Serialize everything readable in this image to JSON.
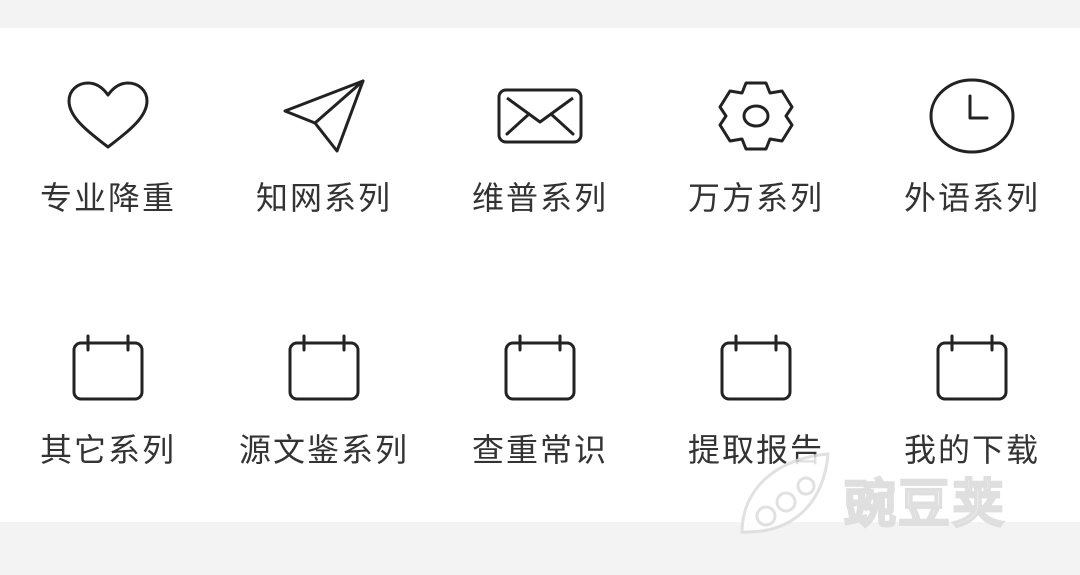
{
  "menu": {
    "items": [
      {
        "label": "专业降重",
        "icon": "heart-icon"
      },
      {
        "label": "知网系列",
        "icon": "paper-plane-icon"
      },
      {
        "label": "维普系列",
        "icon": "envelope-icon"
      },
      {
        "label": "万方系列",
        "icon": "gear-icon"
      },
      {
        "label": "外语系列",
        "icon": "clock-icon"
      },
      {
        "label": "其它系列",
        "icon": "calendar-icon"
      },
      {
        "label": "源文鉴系列",
        "icon": "calendar-icon"
      },
      {
        "label": "查重常识",
        "icon": "calendar-icon"
      },
      {
        "label": "提取报告",
        "icon": "calendar-icon"
      },
      {
        "label": "我的下载",
        "icon": "calendar-icon"
      }
    ]
  },
  "watermark": {
    "text": "豌豆荚",
    "icon": "pea-pod-logo-icon"
  },
  "colors": {
    "background": "#f3f3f3",
    "panel": "#ffffff",
    "text": "#333333",
    "icon_stroke": "#222222"
  }
}
